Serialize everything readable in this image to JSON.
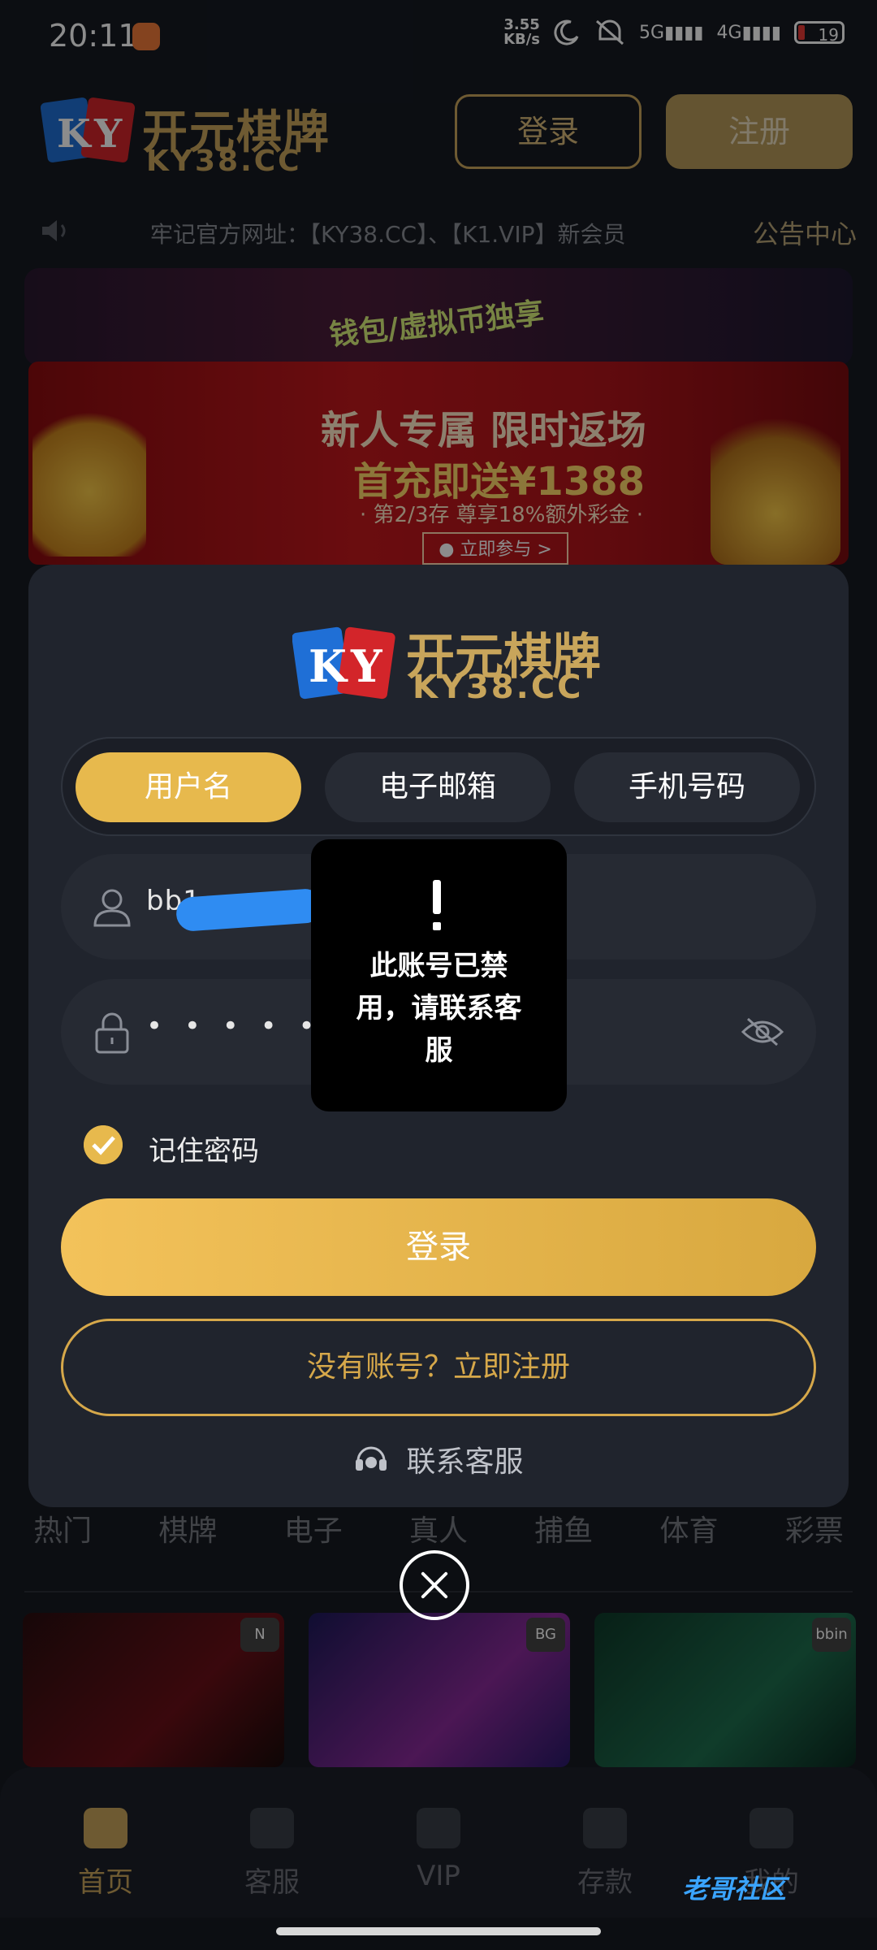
{
  "status_bar": {
    "time": "20:11",
    "network_speed_value": "3.55",
    "network_speed_unit": "KB/s",
    "signal1": "5G",
    "signal2": "4G",
    "battery": "19"
  },
  "header": {
    "logo_cn": "开元棋牌",
    "logo_url": "KY38.CC",
    "logo_mark": "KY",
    "login_label": "登录",
    "register_label": "注册"
  },
  "marquee": {
    "text": "牢记官方网址：【KY38.CC】、【K1.VIP】新会员",
    "notice_center": "公告中心"
  },
  "banners": {
    "back_text": "钱包/虚拟币独享",
    "front_title": "新人专属 限时返场",
    "front_sub": "首充即送¥1388",
    "front_small": "· 第2/3存 尊享18%额外彩金 ·",
    "front_button": "● 立即参与 >"
  },
  "categories": [
    "热门",
    "棋牌",
    "电子",
    "真人",
    "捕鱼",
    "体育",
    "彩票"
  ],
  "tiles": [
    {
      "badge": "N"
    },
    {
      "badge": "BG"
    },
    {
      "badge": "bbin"
    }
  ],
  "bottom_nav": [
    {
      "label": "首页",
      "active": true
    },
    {
      "label": "客服",
      "active": false
    },
    {
      "label": "VIP",
      "active": false
    },
    {
      "label": "存款",
      "active": false
    },
    {
      "label": "我的",
      "active": false
    }
  ],
  "watermark": "老哥社区",
  "modal": {
    "logo_cn": "开元棋牌",
    "logo_url": "KY38.CC",
    "tabs": [
      {
        "label": "用户名",
        "active": true
      },
      {
        "label": "电子邮箱",
        "active": false
      },
      {
        "label": "手机号码",
        "active": false
      }
    ],
    "username_value": "bb1",
    "password_value": "• • • • • • •",
    "remember_label": "记住密码",
    "remember_checked": true,
    "login_button": "登录",
    "register_link": "没有账号？立即注册",
    "support_label": "联系客服"
  },
  "toast": {
    "icon": "!",
    "message": "此账号已禁用，请联系客服"
  },
  "colors": {
    "background": "#161a22",
    "modal": "#20242d",
    "accent_gold": "#e7b94d",
    "text_gold": "#c8a55b"
  }
}
